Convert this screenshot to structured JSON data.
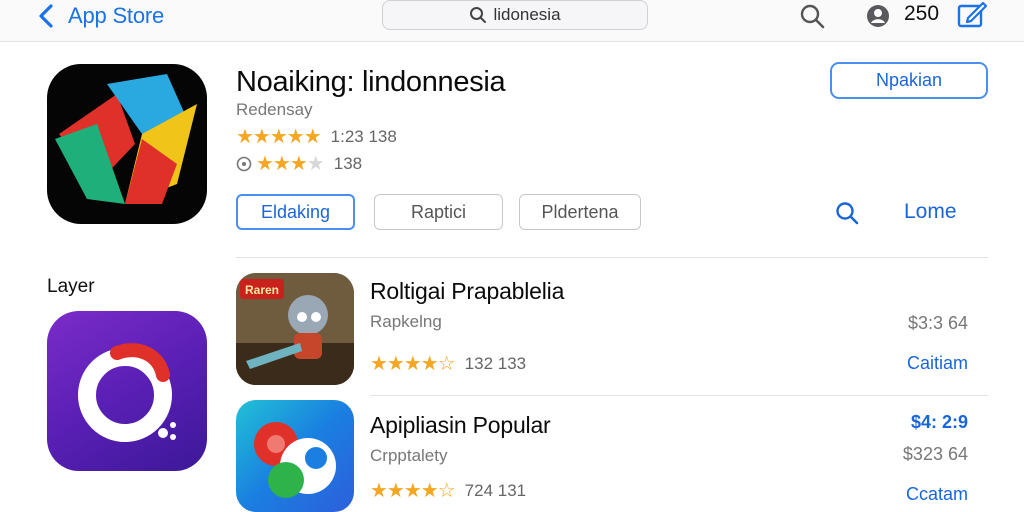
{
  "topbar": {
    "back_label": "App Store",
    "search_value": "lidonesia",
    "count": "250"
  },
  "featured": {
    "title": "Noaiking: lindonnesia",
    "subtitle": "Redensay",
    "rating1_text": "1:23 138",
    "rating1_stars": 5,
    "rating2_text": "138",
    "rating2_stars": 3,
    "open_label": "Npakian",
    "pills": [
      "Eldaking",
      "Raptici",
      "Pldertena"
    ],
    "link_label": "Lome"
  },
  "layer_section": {
    "label": "Layer"
  },
  "rows": [
    {
      "title": "Roltigai Prapablelia",
      "subtitle": "Rapkelng",
      "rating_text": "132 133",
      "stars": 4.5,
      "price": "$3:3 64",
      "action": "Caitiam",
      "badge": "Raren"
    },
    {
      "title": "Apipliasin Popular",
      "subtitle": "Crpptalety",
      "rating_text": "724 131",
      "stars": 4.5,
      "price_blue": "$4: 2:9",
      "price": "$323 64",
      "action": "Ccatam"
    }
  ],
  "colors": {
    "accent": "#1a66d8",
    "star": "#f5a623",
    "layer_icon": "#5a1fb5"
  }
}
